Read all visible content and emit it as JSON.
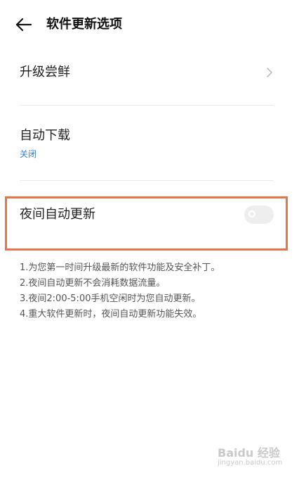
{
  "header": {
    "title": "软件更新选项"
  },
  "rows": {
    "upgrade_preview": {
      "label": "升级尝鲜"
    },
    "auto_download": {
      "label": "自动下载",
      "value": "关闭"
    },
    "night_auto_update": {
      "label": "夜间自动更新",
      "toggle_state": "off"
    }
  },
  "notes": [
    "1.为您第一时间升级最新的软件功能及安全补丁。",
    "2.夜间自动更新不会消耗数据流量。",
    "3.夜间2:00-5:00手机空闲时为您自动更新。",
    "4.重大软件更新时，夜间自动更新功能失效。"
  ],
  "watermark": {
    "logo": "Baidu 经验",
    "url": "jingyan.baidu.com"
  },
  "colors": {
    "highlight_border": "#e8744c",
    "link_blue": "#2a7fd4"
  }
}
